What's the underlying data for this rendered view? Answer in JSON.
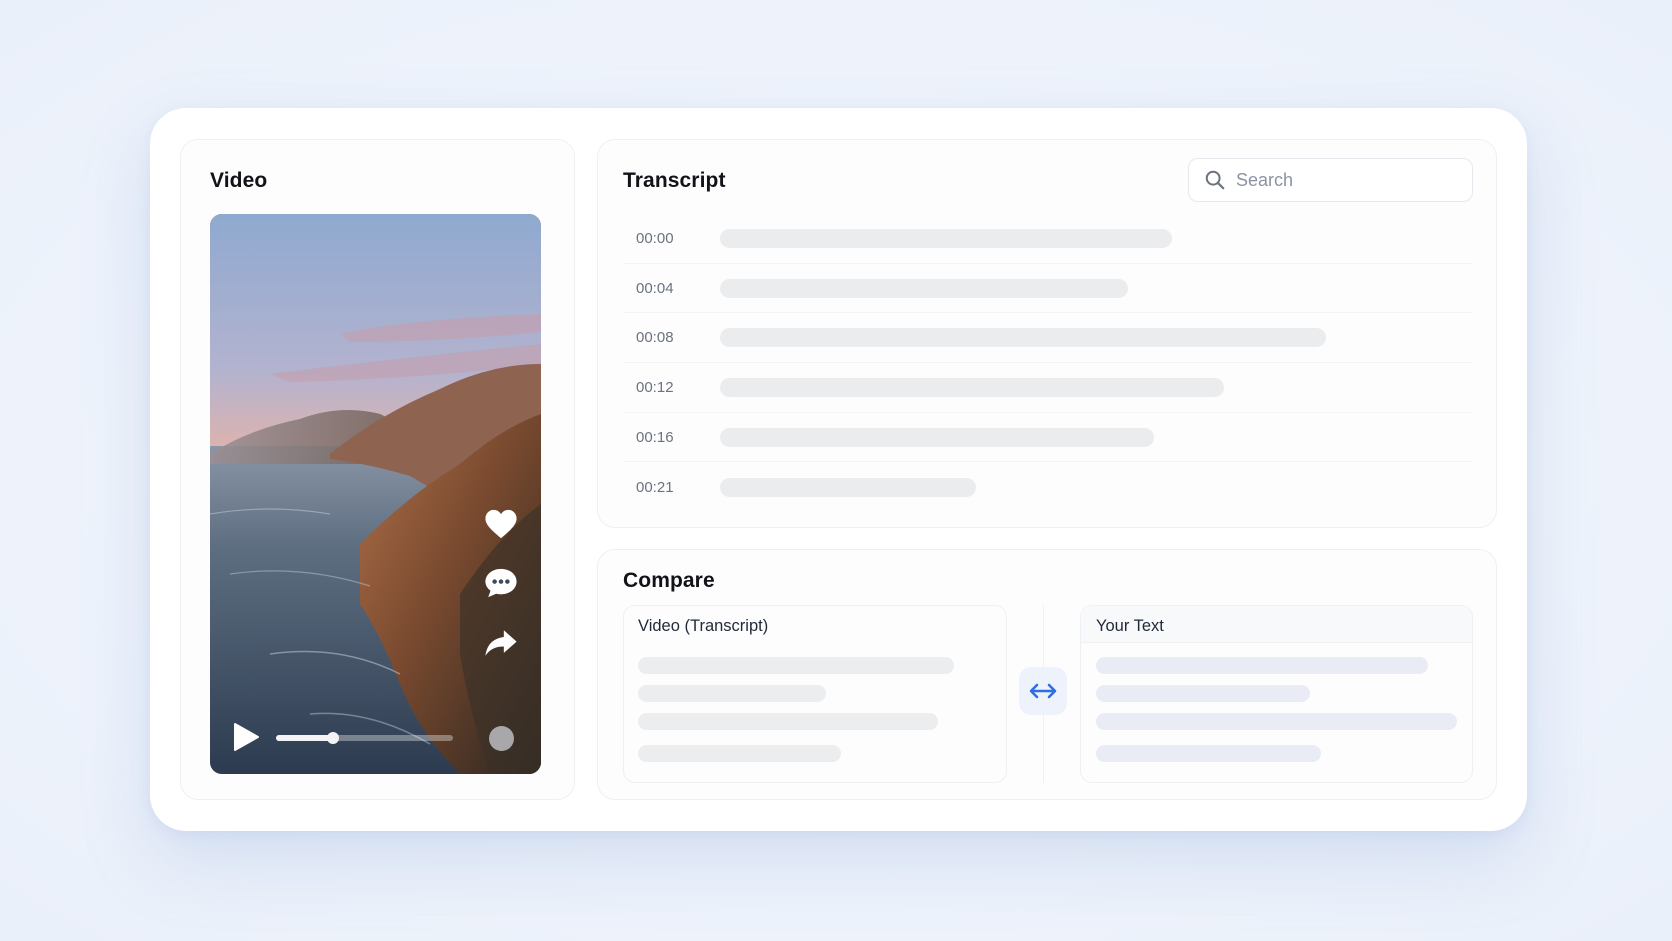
{
  "video": {
    "title": "Video",
    "progress": 0.32,
    "icons": {
      "like": "heart-icon",
      "comment": "comment-icon",
      "share": "share-icon",
      "play": "play-icon"
    }
  },
  "transcript": {
    "title": "Transcript",
    "search": {
      "placeholder": "Search",
      "value": ""
    },
    "rows": [
      {
        "time": "00:00"
      },
      {
        "time": "00:04"
      },
      {
        "time": "00:08"
      },
      {
        "time": "00:12"
      },
      {
        "time": "00:16"
      },
      {
        "time": "00:21"
      }
    ]
  },
  "compare": {
    "title": "Compare",
    "left_label": "Video (Transcript)",
    "right_label": "Your Text",
    "swap_icon": "swap-arrows-icon"
  },
  "colors": {
    "accent": "#2f6fe4",
    "placeholder": "#ebecee",
    "page_background": "#eef3fb"
  }
}
